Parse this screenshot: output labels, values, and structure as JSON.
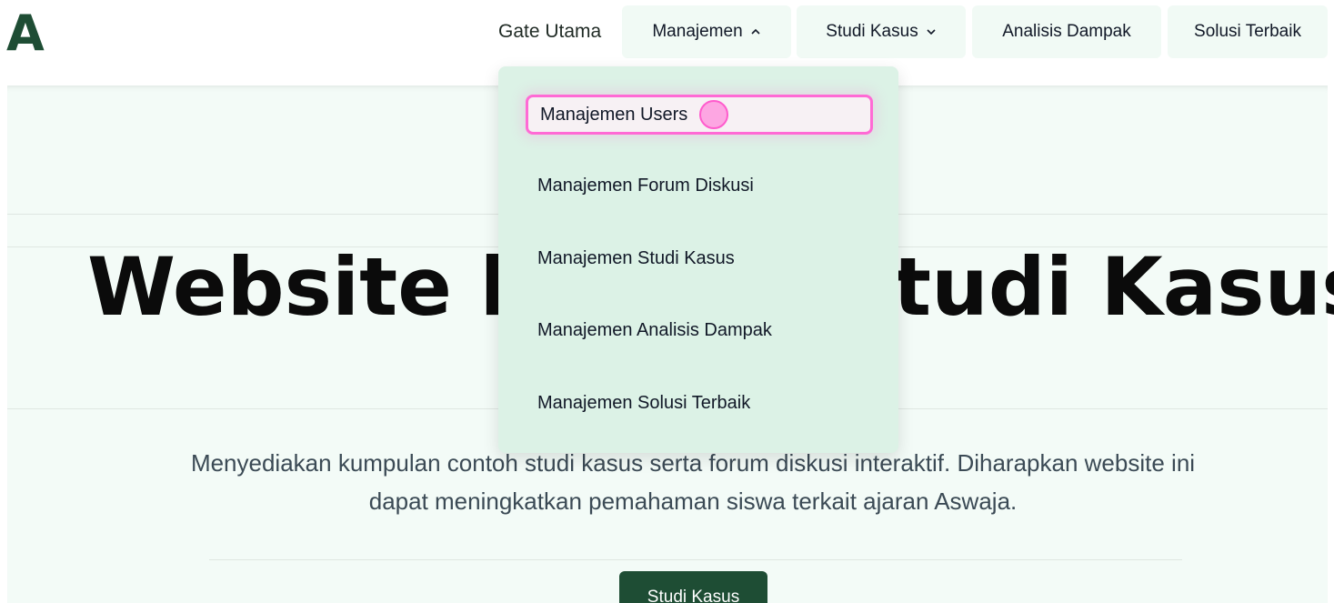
{
  "header": {
    "logo": "A",
    "nav": {
      "gate_utama": "Gate Utama",
      "manajemen": "Manajemen",
      "studi_kasus": "Studi Kasus",
      "analisis_dampak": "Analisis Dampak",
      "solusi_terbaik": "Solusi Terbaik"
    }
  },
  "dropdown": {
    "items": [
      {
        "label": "Manajemen Users",
        "active": true
      },
      {
        "label": "Manajemen Forum Diskusi"
      },
      {
        "label": "Manajemen Studi Kasus"
      },
      {
        "label": "Manajemen Analisis Dampak"
      },
      {
        "label": "Manajemen Solusi Terbaik"
      }
    ]
  },
  "hero": {
    "title_left": "Website ku",
    "title_right": "tudi Kasus",
    "description": "Menyediakan kumpulan contoh studi kasus serta forum diskusi interaktif. Diharapkan website ini dapat meningkatkan pemahaman siswa terkait ajaran Aswaja.",
    "cta_label": "Studi Kasus"
  },
  "colors": {
    "brand": "#1e4d34",
    "hero_bg": "#f3fbf7",
    "dropdown_bg": "#dcf2e6",
    "highlight": "#ff6ad5"
  },
  "icons": {
    "chevron_up": "chevron-up-icon",
    "chevron_down": "chevron-down-icon"
  }
}
